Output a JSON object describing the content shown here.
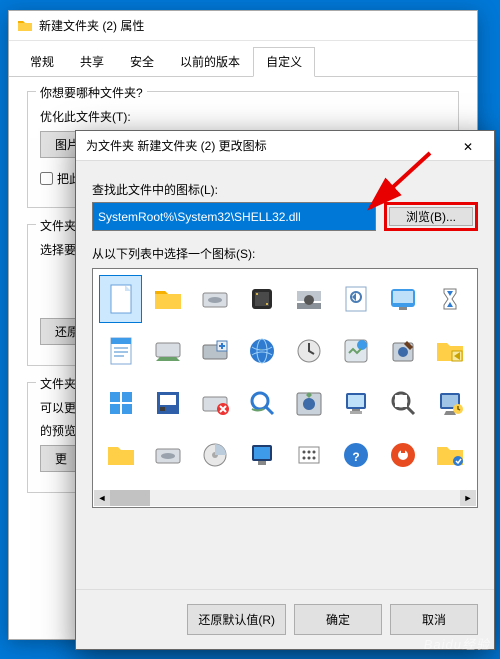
{
  "props": {
    "title": "新建文件夹 (2) 属性",
    "tabs": [
      "常规",
      "共享",
      "安全",
      "以前的版本",
      "自定义"
    ],
    "active_tab": 4,
    "group1": {
      "title": "你想要哪种文件夹?",
      "opt_label": "优化此文件夹(T):",
      "btn": "图片",
      "chk": "把此"
    },
    "group2": {
      "title": "文件夹图",
      "label": "选择要在",
      "restore": "还原"
    },
    "group3": {
      "title": "文件夹图",
      "line1": "可以更改",
      "line2": "的预览。",
      "btn": "更"
    }
  },
  "dlg": {
    "title": "为文件夹 新建文件夹 (2) 更改图标",
    "look_label": "查找此文件中的图标(L):",
    "path": "SystemRoot%\\System32\\SHELL32.dll",
    "browse": "浏览(B)...",
    "select_label": "从以下列表中选择一个图标(S):",
    "restore": "还原默认值(R)",
    "ok": "确定",
    "cancel": "取消"
  },
  "watermark": "Baidu经验"
}
